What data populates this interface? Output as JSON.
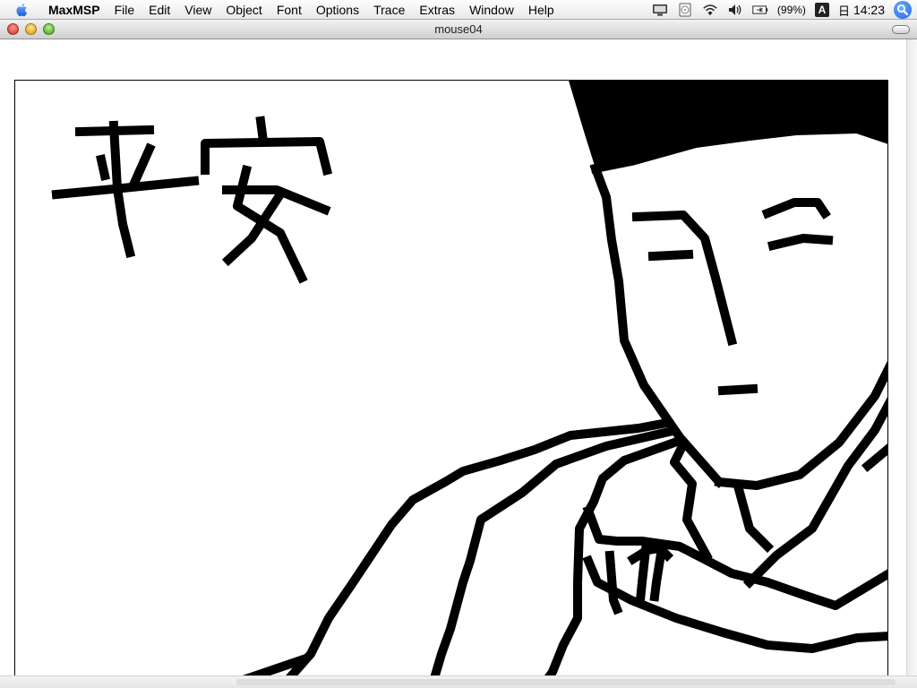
{
  "menubar": {
    "app_name": "MaxMSP",
    "items": [
      "File",
      "Edit",
      "View",
      "Object",
      "Font",
      "Options",
      "Trace",
      "Extras",
      "Window",
      "Help"
    ],
    "battery_percent": "(99%)",
    "input_method": "A",
    "calendar_glyph": "日",
    "time": "14:23"
  },
  "window": {
    "title": "mouse04"
  },
  "canvas": {
    "description_icons": [
      "apple-icon",
      "display-icon",
      "cd-icon",
      "wifi-icon",
      "volume-icon",
      "battery-icon",
      "spotlight-icon"
    ],
    "colors": {
      "ink": "#000000",
      "paper": "#ffffff"
    }
  }
}
